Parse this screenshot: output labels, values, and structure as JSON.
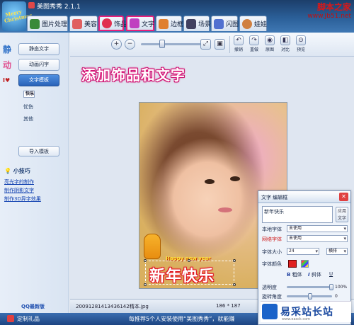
{
  "app": {
    "title": "美图秀秀 2.1.1",
    "logo_text": "Merry Christmas"
  },
  "watermark": {
    "line1": "脚本之家",
    "line2": "www.Jb51.net"
  },
  "tabs": [
    {
      "label": "图片处理",
      "color": "#3a8a3a"
    },
    {
      "label": "美容",
      "color": "#e06060"
    },
    {
      "label": "饰品",
      "color": "#e03050",
      "highlighted": true
    },
    {
      "label": "文字",
      "color": "#c040c0",
      "highlighted": true
    },
    {
      "label": "边框",
      "color": "#e08030"
    },
    {
      "label": "场景",
      "color": "#404060"
    },
    {
      "label": "闪图",
      "color": "#5070d0"
    },
    {
      "label": "娃娃",
      "color": "#d08040"
    }
  ],
  "left_panel": {
    "static_text": "静态文字",
    "animated_text": "动画闪字",
    "text_template": "文字模板",
    "sub_items": [
      "快乐",
      "忧伤",
      "其他"
    ],
    "import_button": "导入模板",
    "tips_title": "小技巧",
    "tip_links": [
      "亮光字的制作",
      "制作阴影文字",
      "制作3D异字效果"
    ],
    "qq": "QQ最新版"
  },
  "toolbar": {
    "zoom_level": 0.3,
    "buttons": [
      "撤销",
      "重做",
      "原图",
      "对比",
      "预览"
    ]
  },
  "banner": "添加饰品和文字",
  "photo": {
    "happy_text": "Happy new year",
    "greeting": "新年快乐"
  },
  "status": {
    "filename": "20091281413436142精本.jpg",
    "size": "186 * 187"
  },
  "bottom": {
    "gift_label": "定制礼品",
    "ticker": "每推荐5个人安装使用“美图秀秀”，就能赚"
  },
  "dialog": {
    "title": "文字 编辑框",
    "text_value": "新年快乐",
    "apply_label": "应用文字",
    "local_font_label": "本地字体",
    "local_font_value": "未使用",
    "web_font_label": "网络字体",
    "web_font_value": "未使用",
    "font_size_label": "字体大小",
    "font_size_value": "24",
    "orientation_value": "横排",
    "font_color_label": "字体颜色",
    "font_color": "#e02020",
    "bold": "粗体",
    "italic": "斜体",
    "underline": "U",
    "opacity_label": "透明度",
    "opacity_value": "100%",
    "rotation_label": "旋转角度",
    "rotation_value": "0"
  },
  "brand": {
    "name": "易采站长站",
    "url": "www.easck.com"
  }
}
